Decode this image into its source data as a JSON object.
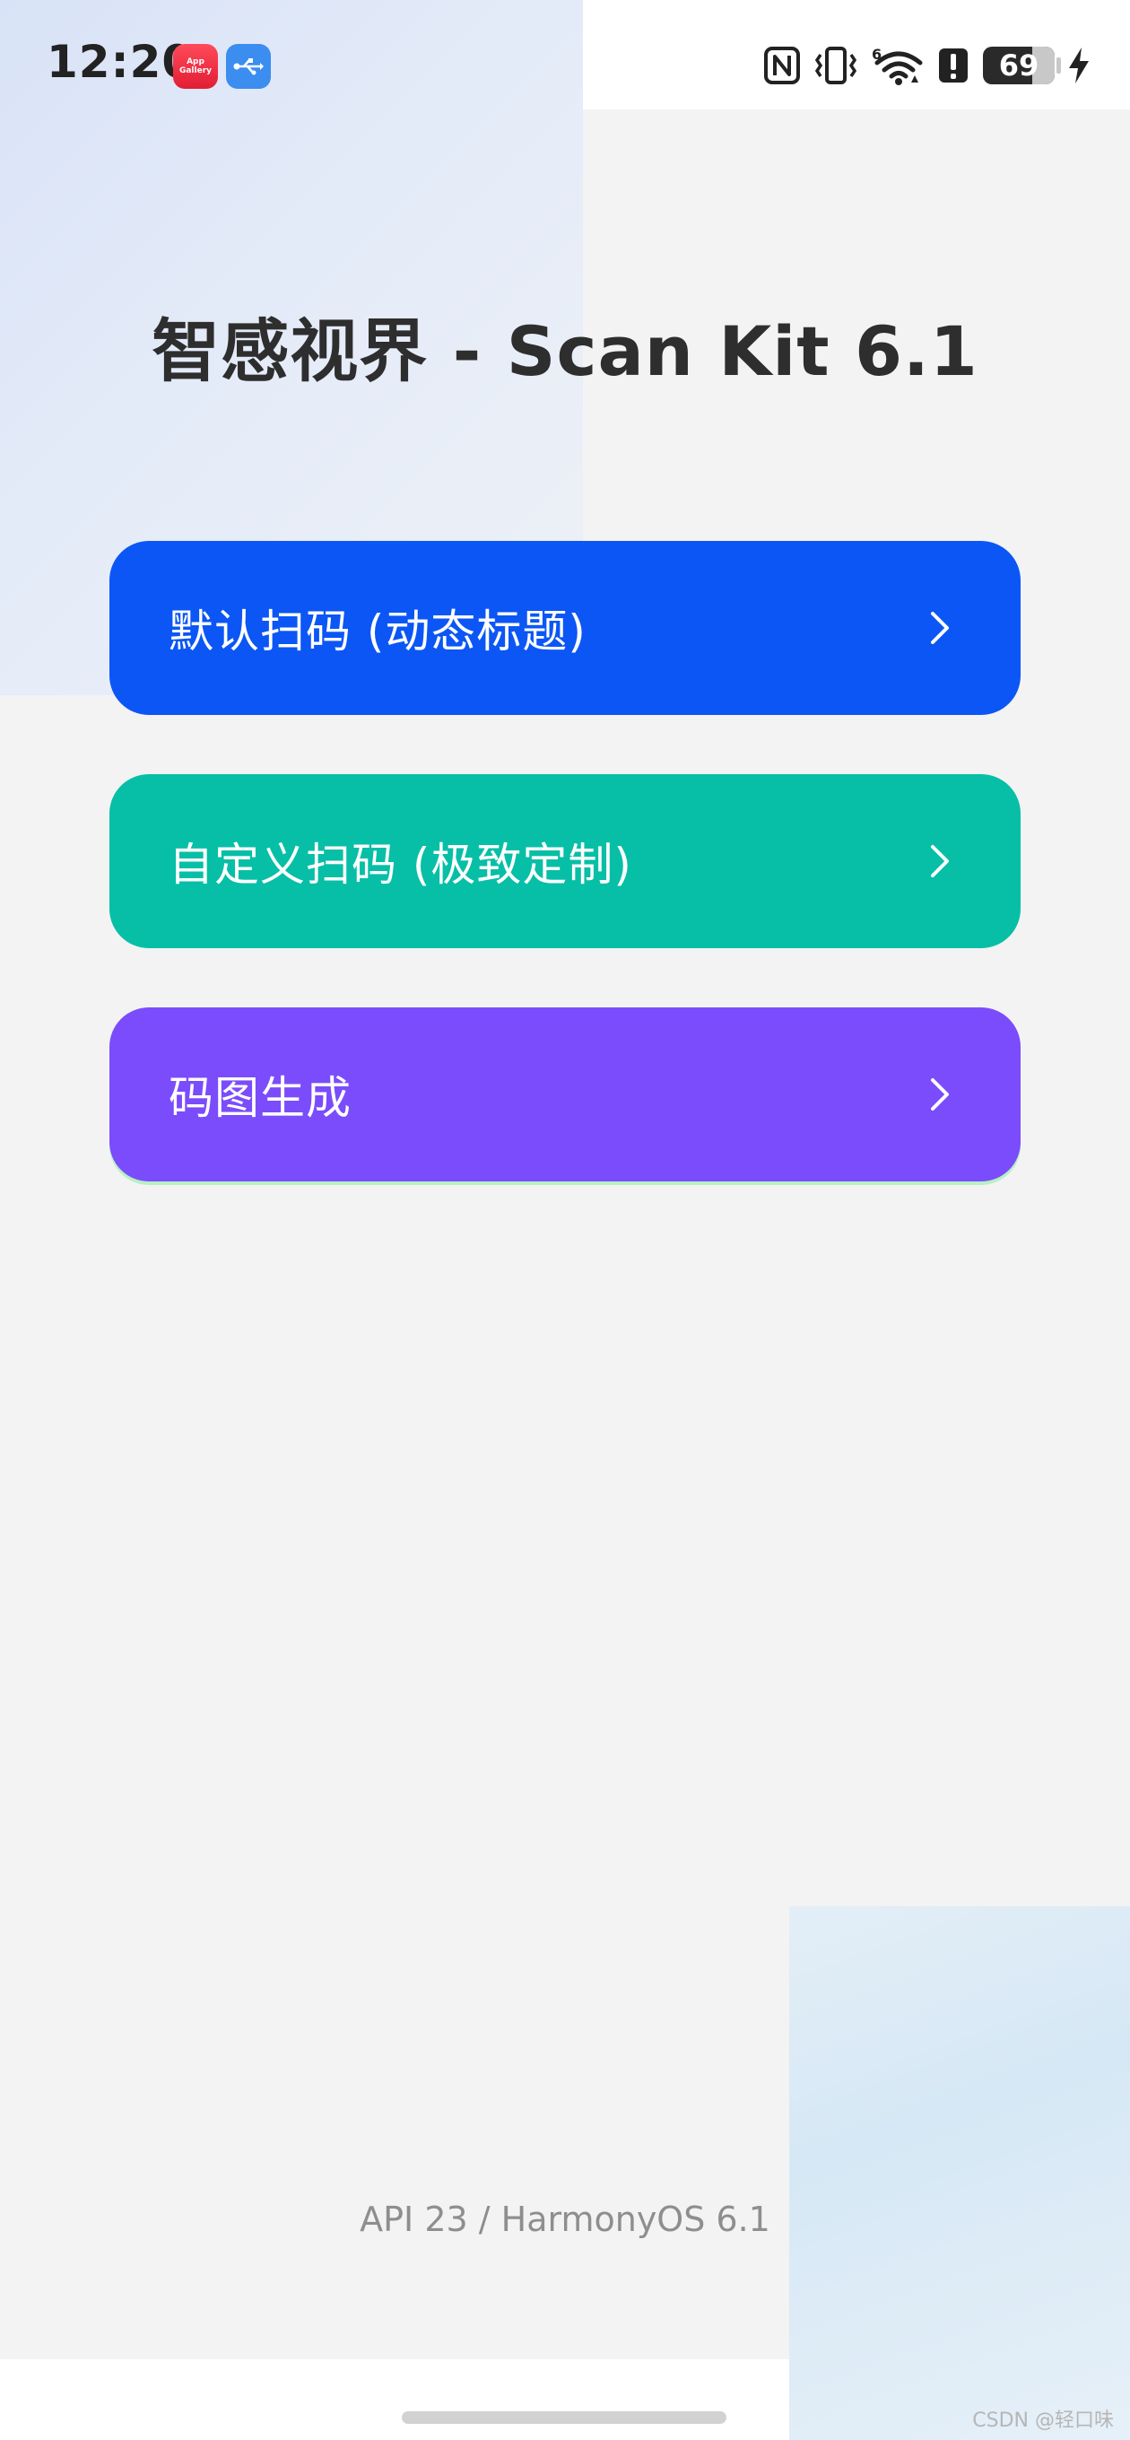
{
  "status_bar": {
    "time": "12:20",
    "notification_apps": [
      {
        "name": "AppGallery",
        "label_line1": "App",
        "label_line2": "Gallery",
        "color": "#e21d34"
      },
      {
        "name": "USB",
        "color": "#3b8df0"
      }
    ],
    "wifi_badge": "6",
    "battery_level": "69",
    "battery_fraction": 0.69,
    "charging": true
  },
  "title": "智感视界 - Scan Kit 6.1",
  "menu": [
    {
      "label": "默认扫码 (动态标题)",
      "color": "#0b56f5",
      "icon": "chevron-right-icon"
    },
    {
      "label": "自定义扫码 (极致定制)",
      "color": "#06bfa6",
      "icon": "chevron-right-icon"
    },
    {
      "label": "码图生成",
      "color": "#7b4cfb",
      "icon": "chevron-right-icon"
    }
  ],
  "footer": {
    "api_info": "API 23 / HarmonyOS 6.1"
  },
  "watermark": "CSDN @轻口味"
}
